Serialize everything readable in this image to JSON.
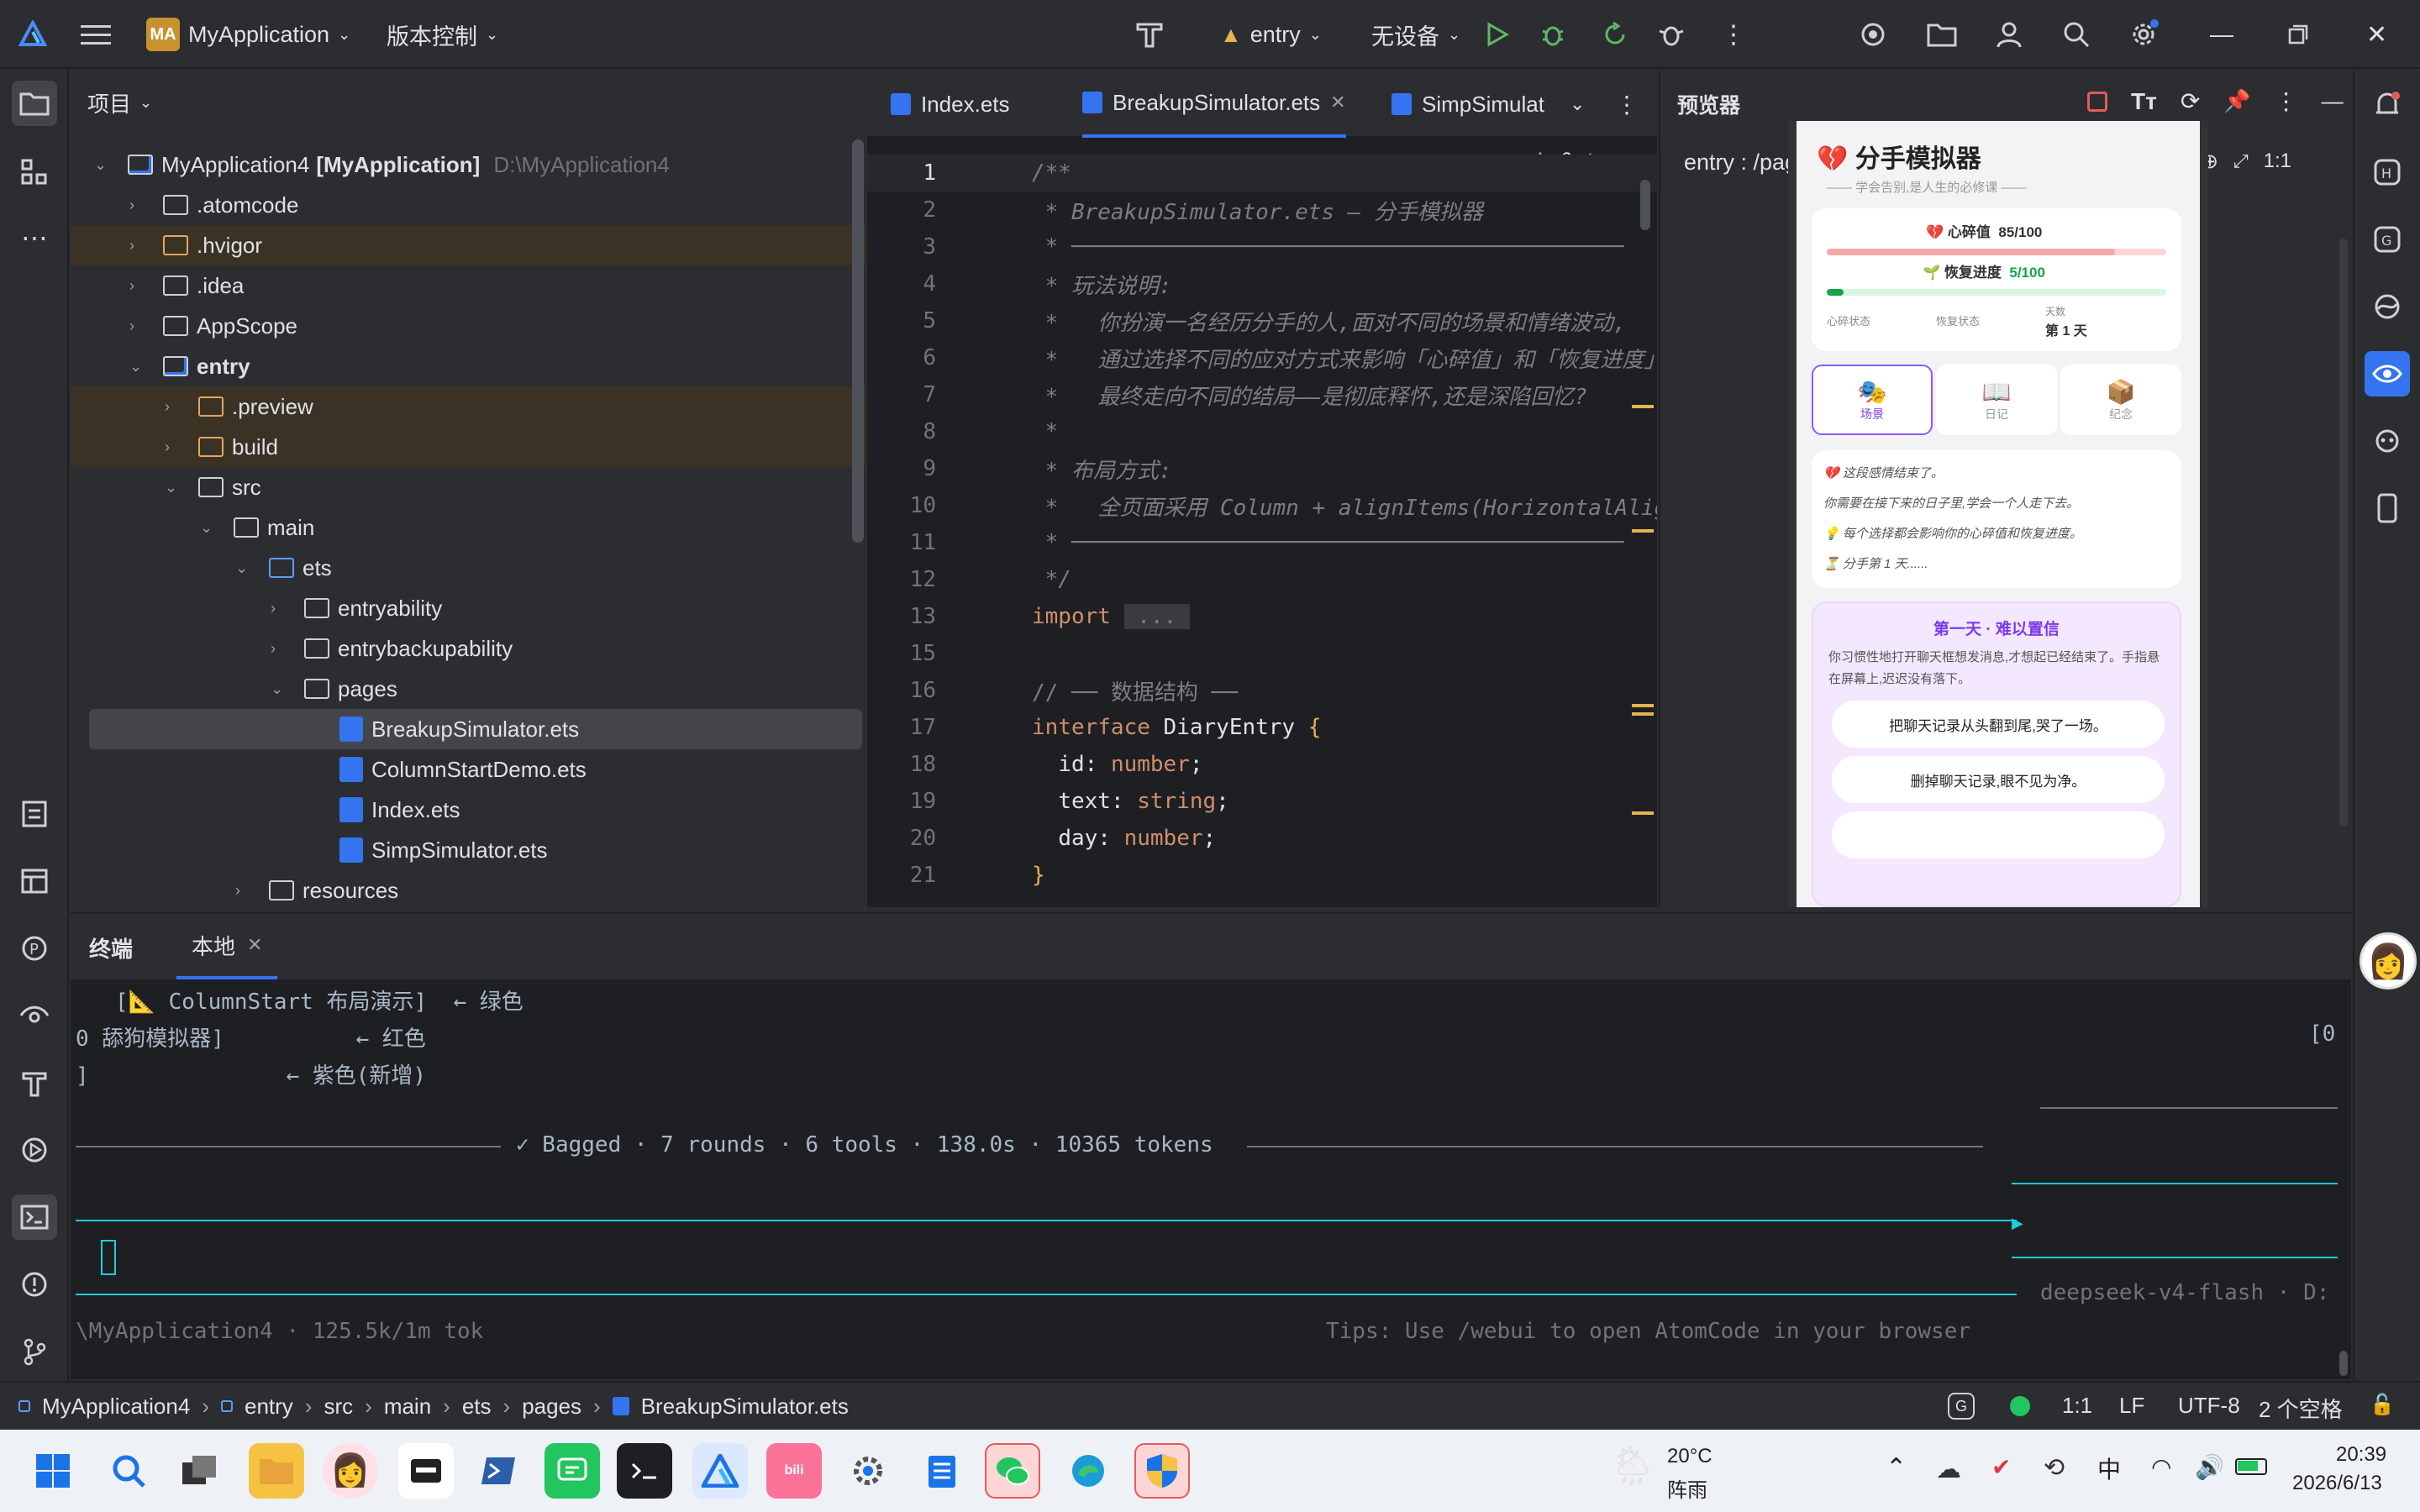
{
  "titlebar": {
    "logo_badge": "MA",
    "project_name": "MyApplication",
    "vcs_menu": "版本控制",
    "run_config": "entry",
    "device": "无设备"
  },
  "project_panel": {
    "title": "项目",
    "tree": [
      {
        "label": "MyApplication4",
        "bold_suffix": "[MyApplication]",
        "path": "D:\\MyApplication4",
        "depth": 0,
        "expanded": true,
        "kind": "module"
      },
      {
        "label": ".atomcode",
        "depth": 1,
        "kind": "folder"
      },
      {
        "label": ".hvigor",
        "depth": 1,
        "kind": "folder-orange"
      },
      {
        "label": ".idea",
        "depth": 1,
        "kind": "folder"
      },
      {
        "label": "AppScope",
        "depth": 1,
        "kind": "folder"
      },
      {
        "label": "entry",
        "depth": 1,
        "kind": "module",
        "expanded": true
      },
      {
        "label": ".preview",
        "depth": 2,
        "kind": "folder-orange"
      },
      {
        "label": "build",
        "depth": 2,
        "kind": "folder-orange"
      },
      {
        "label": "src",
        "depth": 2,
        "kind": "folder",
        "expanded": true
      },
      {
        "label": "main",
        "depth": 3,
        "kind": "folder",
        "expanded": true
      },
      {
        "label": "ets",
        "depth": 4,
        "kind": "folder-blue",
        "expanded": true
      },
      {
        "label": "entryability",
        "depth": 5,
        "kind": "folder"
      },
      {
        "label": "entrybackupability",
        "depth": 5,
        "kind": "folder"
      },
      {
        "label": "pages",
        "depth": 5,
        "kind": "folder",
        "expanded": true
      },
      {
        "label": "BreakupSimulator.ets",
        "depth": 6,
        "kind": "file",
        "selected": true
      },
      {
        "label": "ColumnStartDemo.ets",
        "depth": 6,
        "kind": "file"
      },
      {
        "label": "Index.ets",
        "depth": 6,
        "kind": "file"
      },
      {
        "label": "SimpSimulator.ets",
        "depth": 6,
        "kind": "file"
      },
      {
        "label": "resources",
        "depth": 4,
        "kind": "folder"
      }
    ]
  },
  "editor": {
    "tabs": [
      {
        "label": "Index.ets",
        "active": false
      },
      {
        "label": "BreakupSimulator.ets",
        "active": true
      },
      {
        "label": "SimpSimulat",
        "active": false
      }
    ],
    "warning_count": "6",
    "lines": [
      {
        "n": "1",
        "html": "<span class='cm'>/**</span>"
      },
      {
        "n": "2",
        "html": "<span class='cm'> * BreakupSimulator.ets — 分手模拟器</span>"
      },
      {
        "n": "3",
        "html": "<span class='cm'> * ──────────────────────────────────────────</span>"
      },
      {
        "n": "4",
        "html": "<span class='cm'> * 玩法说明:</span>"
      },
      {
        "n": "5",
        "html": "<span class='cm'> *   你扮演一名经历分手的人,面对不同的场景和情绪波动,</span>"
      },
      {
        "n": "6",
        "html": "<span class='cm'> *   通过选择不同的应对方式来影响「心碎值」和「恢复进度」</span>"
      },
      {
        "n": "7",
        "html": "<span class='cm'> *   最终走向不同的结局——是彻底释怀,还是深陷回忆?</span>"
      },
      {
        "n": "8",
        "html": "<span class='cm'> *</span>"
      },
      {
        "n": "9",
        "html": "<span class='cm'> * 布局方式:</span>"
      },
      {
        "n": "10",
        "html": "<span class='cm'> *   全页面采用 Column + alignItems(HorizontalAlign</span>"
      },
      {
        "n": "11",
        "html": "<span class='cm'> * ──────────────────────────────────────────</span>"
      },
      {
        "n": "12",
        "html": "<span class='cm'> */</span>"
      },
      {
        "n": "13",
        "html": "<span class='kw'>import</span> <span style='background:#393b40;color:#7a7e85'> ... </span>"
      },
      {
        "n": "15",
        "html": ""
      },
      {
        "n": "16",
        "html": "<span style='color:#7a7e85'>// ── 数据结构 ──</span>"
      },
      {
        "n": "17",
        "html": "<span class='kw'>interface</span> <span class='fn'>DiaryEntry</span> <span style='color:#e6b34d'>{</span>"
      },
      {
        "n": "18",
        "html": "  <span class='fn'>id</span>: <span class='kw'>number</span>;"
      },
      {
        "n": "19",
        "html": "  <span class='fn'>text</span>: <span class='kw'>string</span>;"
      },
      {
        "n": "20",
        "html": "  <span class='fn'>day</span>: <span class='kw'>number</span>;"
      },
      {
        "n": "21",
        "html": "<span style='color:#e6b34d'>}</span>"
      }
    ]
  },
  "preview": {
    "title": "预览器",
    "route": "entry : /pages/Breaku...",
    "ratio": "1:1",
    "app": {
      "title": "分手模拟器",
      "subtitle": "—— 学会告别,是人生的必修课 ——",
      "heart_label": "心碎值",
      "heart_value": "85/100",
      "heart_fraction": 0.85,
      "recover_label": "恢复进度",
      "recover_value": "5/100",
      "recover_fraction": 0.05,
      "stat1": "心碎状态",
      "stat2": "恢复状态",
      "stat3_label": "天数",
      "stat3_value": "第 1 天",
      "tabs": [
        "场景",
        "日记",
        "纪念"
      ],
      "intro": [
        "这段感情结束了。",
        "你需要在接下来的日子里,学会一个人走下去。",
        "每个选择都会影响你的心碎值和恢复进度。",
        "分手第 1 天......"
      ],
      "scene_title": "第一天 · 难以置信",
      "scene_text": "你习惯性地打开聊天框想发消息,才想起已经结束了。手指悬在屏幕上,迟迟没有落下。",
      "choices": [
        "把聊天记录从头翻到尾,哭了一场。",
        "删掉聊天记录,眼不见为净。"
      ]
    }
  },
  "terminal": {
    "tab_main": "终端",
    "tab_local": "本地",
    "lines": [
      "   [📐 ColumnStart 布局演示]  ← 绿色",
      "0 舔狗模拟器]          ← 红色",
      "]               ← 紫色(新增)"
    ],
    "right_fragment": "[0",
    "summary": "✓ Bagged · 7 rounds · 6 tools · 138.0s · 10365 tokens",
    "path_line": "\\MyApplication4 · 125.5k/1m tok",
    "tips": "Tips: Use /webui to open AtomCode in your browser",
    "model": "deepseek-v4-flash · D:"
  },
  "statusbar": {
    "crumbs": [
      "MyApplication4",
      "entry",
      "src",
      "main",
      "ets",
      "pages",
      "BreakupSimulator.ets"
    ],
    "position": "1:1",
    "line_sep": "LF",
    "encoding": "UTF-8",
    "indent": "2 个空格"
  },
  "taskbar": {
    "weather_temp": "20°C",
    "weather_desc": "阵雨",
    "ime": "中",
    "time": "20:39",
    "date": "2026/6/13"
  },
  "colors": {
    "accent": "#3574f0",
    "editor_bg": "#1e1f22",
    "panel_bg": "#2b2d30",
    "heart_bar": "#f7b7b7",
    "recover_bar": "#22c55e",
    "scene_purple": "#7c3aed"
  }
}
